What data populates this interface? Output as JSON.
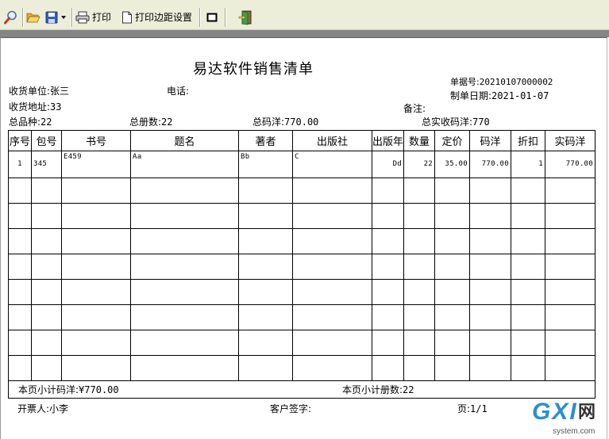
{
  "toolbar": {
    "zoom": {
      "icon": "magnifier-icon"
    },
    "open": {
      "icon": "folder-open-icon"
    },
    "save": {
      "icon": "floppy-disk-icon",
      "dropdown_icon": "dropdown-arrow-icon"
    },
    "print": {
      "icon": "printer-icon",
      "label": "打印"
    },
    "margin": {
      "icon": "page-icon",
      "label": "打印边距设置"
    },
    "frame": {
      "icon": "rectangle-icon"
    },
    "exit": {
      "icon": "exit-door-icon"
    }
  },
  "document": {
    "title": "易达软件销售清单",
    "doc_no": {
      "label": "单据号:",
      "value": "20210107000002"
    },
    "consignee": {
      "label": "收货单位:",
      "value": "张三"
    },
    "phone": {
      "label": "电话:"
    },
    "date": {
      "label": "制单日期:",
      "value": "2021-01-07"
    },
    "address": {
      "label": "收货地址:",
      "value": "33"
    },
    "remark": {
      "label": "备注:"
    },
    "totals": {
      "varieties": {
        "label": "总品种:",
        "value": "22"
      },
      "volumes": {
        "label": "总册数:",
        "value": "22"
      },
      "list_amount": {
        "label": "总码洋:",
        "value": "770.00"
      },
      "actual_amount": {
        "label": "总实收码洋:",
        "value": "770"
      }
    },
    "table": {
      "headers": [
        "序号",
        "包号",
        "书号",
        "题名",
        "著者",
        "出版社",
        "出版年",
        "数量",
        "定价",
        "码洋",
        "折扣",
        "实码洋"
      ],
      "rows": [
        [
          "1",
          "345",
          "E459",
          "Aa",
          "Bb",
          "C",
          "Dd",
          "22",
          "35.00",
          "770.00",
          "1",
          "770.00"
        ]
      ],
      "subtotal_amount": {
        "label": "本页小计码洋:",
        "value": "¥770.00"
      },
      "subtotal_volumes": {
        "label": "本页小计册数:",
        "value": "22"
      }
    },
    "footer": {
      "issuer": {
        "label": "开票人:",
        "value": "小李"
      },
      "signature": {
        "label": "客户签字:"
      },
      "page": {
        "label": "页:",
        "value": "1/1"
      }
    }
  },
  "watermark": {
    "brand": "GXI",
    "brand_cn": "网",
    "domain": "system.com"
  },
  "colors": {
    "toolbar": "#ECEEDA",
    "band": "#858585",
    "page": "#FFFFFF",
    "grid": "#000000",
    "watermark": "#2A8FD0"
  }
}
